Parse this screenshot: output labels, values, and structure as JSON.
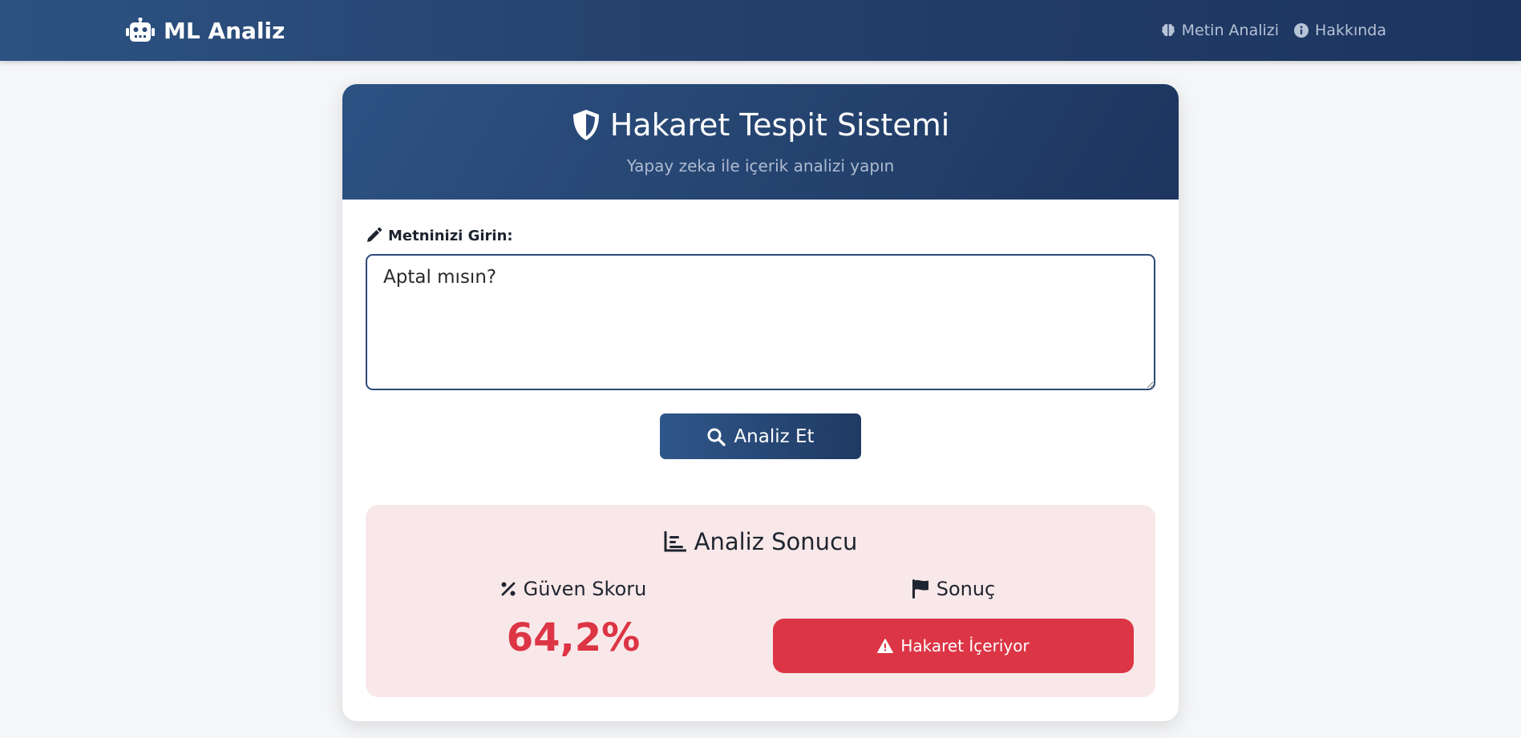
{
  "navbar": {
    "brand": "ML Analiz",
    "brand_icon": "robot-icon",
    "links": [
      {
        "label": "Metin Analizi",
        "icon": "brain-icon"
      },
      {
        "label": "Hakkında",
        "icon": "info-circle-icon"
      }
    ]
  },
  "header": {
    "title": "Hakaret Tespit Sistemi",
    "title_icon": "shield-icon",
    "subtitle": "Yapay zeka ile içerik analizi yapın"
  },
  "form": {
    "label": "Metninizi Girin:",
    "label_icon": "pencil-icon",
    "text_value": "Aptal mısın?",
    "submit_label": "Analiz Et",
    "submit_icon": "search-icon"
  },
  "result": {
    "title": "Analiz Sonucu",
    "title_icon": "chart-icon",
    "score_label": "Güven Skoru",
    "score_icon": "percent-icon",
    "score_value": "64,2%",
    "verdict_label": "Sonuç",
    "verdict_icon": "flag-icon",
    "verdict_text": "Hakaret İçeriyor",
    "verdict_badge_icon": "warning-icon",
    "colors": {
      "danger": "#dc3545",
      "panel_bg": "#f9e8e9"
    }
  },
  "colors": {
    "primary": "#2c5282",
    "primary_dark": "#1c3460"
  }
}
